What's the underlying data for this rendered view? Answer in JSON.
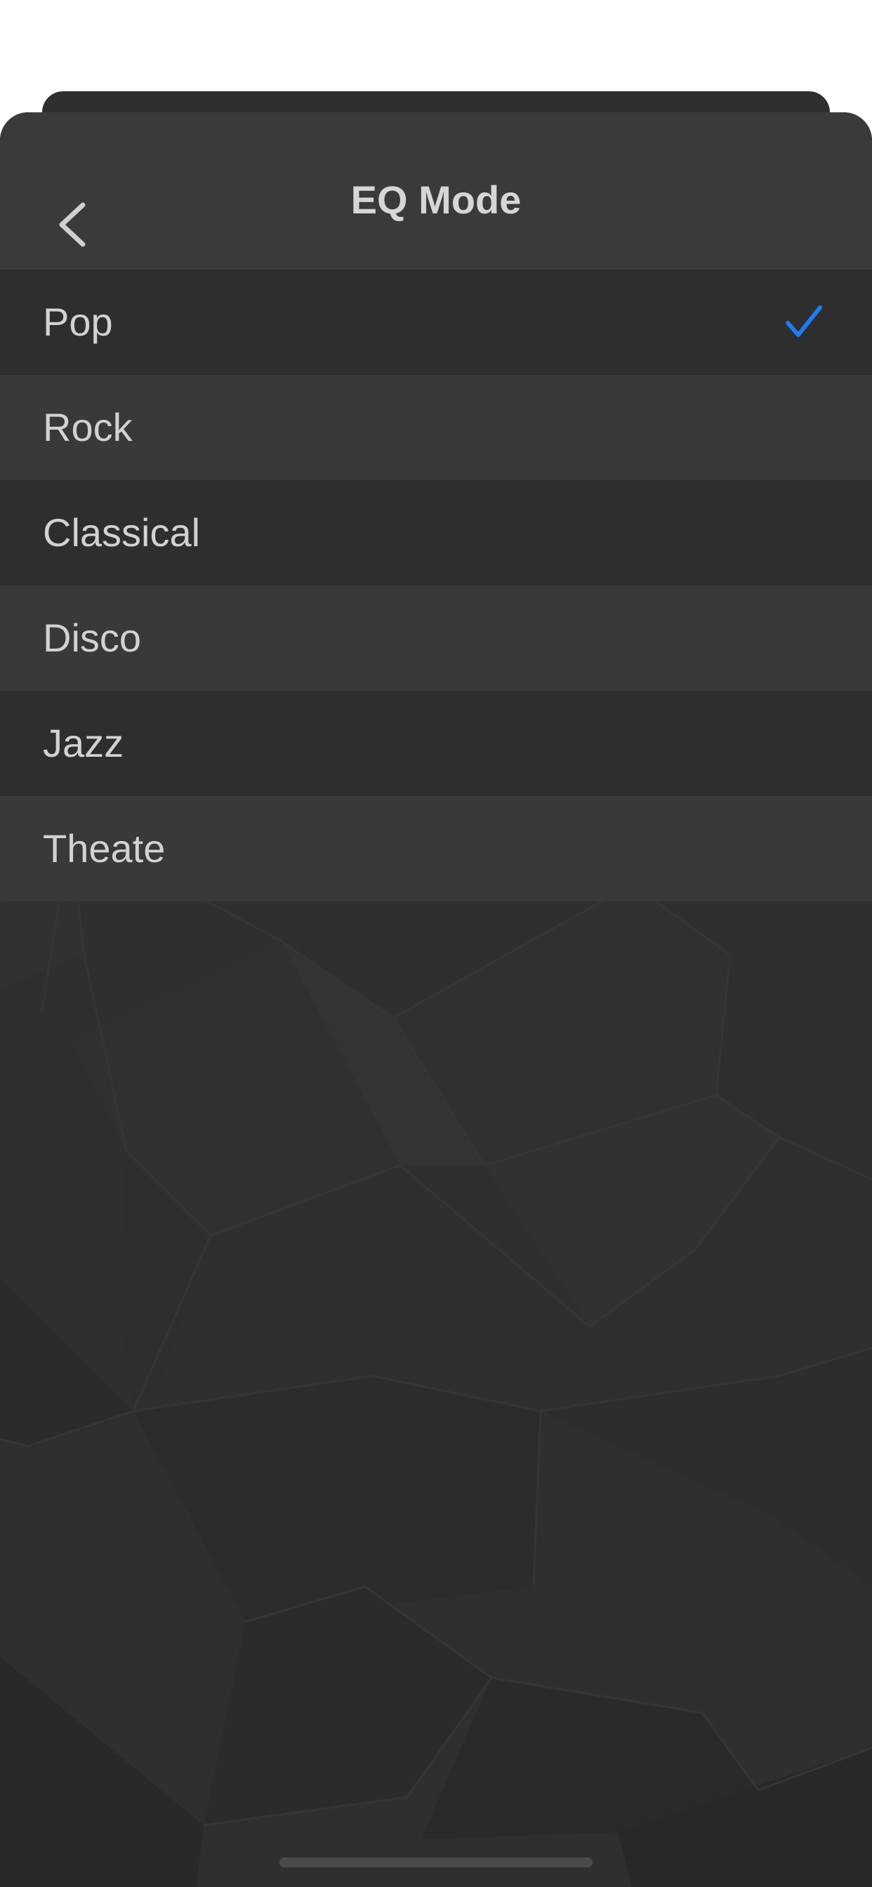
{
  "header": {
    "title": "EQ Mode",
    "back_icon": "chevron-left-icon"
  },
  "eq_modes": {
    "selected_index": 0,
    "check_icon": "checkmark-icon",
    "items": [
      {
        "label": "Pop"
      },
      {
        "label": "Rock"
      },
      {
        "label": "Classical"
      },
      {
        "label": "Disco"
      },
      {
        "label": "Jazz"
      },
      {
        "label": "Theate"
      }
    ]
  },
  "colors": {
    "accent": "#1e7cf2",
    "text": "#d2d2d2",
    "background": "#2f2f2f"
  }
}
